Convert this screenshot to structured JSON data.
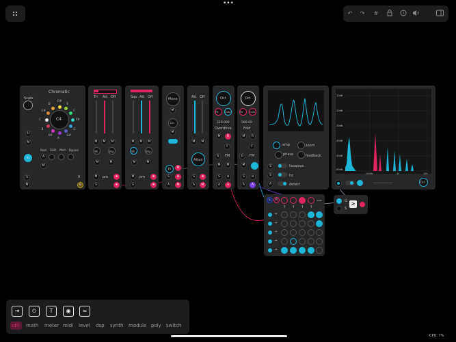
{
  "topbar": {
    "menu_dots": "•••",
    "tools": [
      "undo-icon",
      "redo-icon",
      "grid-icon",
      "lock-icon",
      "info-icon",
      "speaker-icon",
      "sidebar-icon"
    ],
    "tool_glyphs": [
      "↶",
      "↷",
      "#",
      "🔒",
      "ⓘ",
      "🔊",
      "▭"
    ]
  },
  "scale": {
    "title": "Chromatic",
    "scale_label": "Scale",
    "root": "C4",
    "notes": [
      "D#",
      "E",
      "F",
      "F#",
      "G",
      "G#",
      "A",
      "A#",
      "B",
      "C",
      "C#",
      "D"
    ],
    "buttons": [
      "Root",
      "Shift",
      "Pitch",
      "Bypass"
    ],
    "value_zero": "0",
    "m": "M"
  },
  "lfo1": {
    "labels": [
      "Tri",
      "Att",
      "Off"
    ],
    "pm": "pm",
    "wi": "Wi",
    "shp": "Shp"
  },
  "lfo2": {
    "labels": [
      "Squ",
      "Att",
      "Off"
    ],
    "pm": "pm",
    "wi": "Wi",
    "shp": "Shp"
  },
  "mono": {
    "label": "Mono",
    "ml": "M",
    "lin": "Lin"
  },
  "atten": {
    "labels": [
      "Att",
      "Off"
    ],
    "atten": "Atten"
  },
  "osc1": {
    "oct": "Oct",
    "pitch_l": "Pit",
    "pitch_r": "Gate",
    "readout": "220.000",
    "mode": "Overdrive",
    "fm": "FM",
    "f": "F",
    "r": "R"
  },
  "osc2": {
    "oct": "Oct",
    "pitch_l": "Pit",
    "pitch_r": "Gate",
    "readout": "560.00",
    "mode": "Fold",
    "fm": "FM",
    "f": "F",
    "r": "R"
  },
  "scope": {
    "amp": "amp",
    "zoom": "zoom",
    "phase": "phase",
    "feedback": "feedback",
    "lissajous": "lissajous",
    "hz": "hz",
    "detect": "detect",
    "s": "S"
  },
  "spectrum": {
    "db_ticks": [
      "-10dB",
      "-20dB",
      "-30dB",
      "-40dB",
      "-50dB",
      "-60dB"
    ],
    "freq_ticks": [
      "100Hz",
      "1k",
      "10k"
    ],
    "oct": "Oct"
  },
  "seq": {
    "top_label": "reset",
    "cols": [
      "↑",
      "↑",
      "↑",
      "↑"
    ]
  },
  "out": {
    "g": "G",
    "s": "S"
  },
  "palette": {
    "icons": [
      "input-icon",
      "clock-icon",
      "text-icon",
      "record-icon",
      "scope-icon"
    ],
    "icon_glyphs": [
      "⇥",
      "⏲",
      "T",
      "◉",
      "≈"
    ],
    "categories": [
      "util",
      "math",
      "meter",
      "midi",
      "level",
      "dsp",
      "synth",
      "module",
      "poly",
      "switch"
    ],
    "active_category": "util"
  },
  "status": {
    "cpu": "CPU: 7%"
  }
}
